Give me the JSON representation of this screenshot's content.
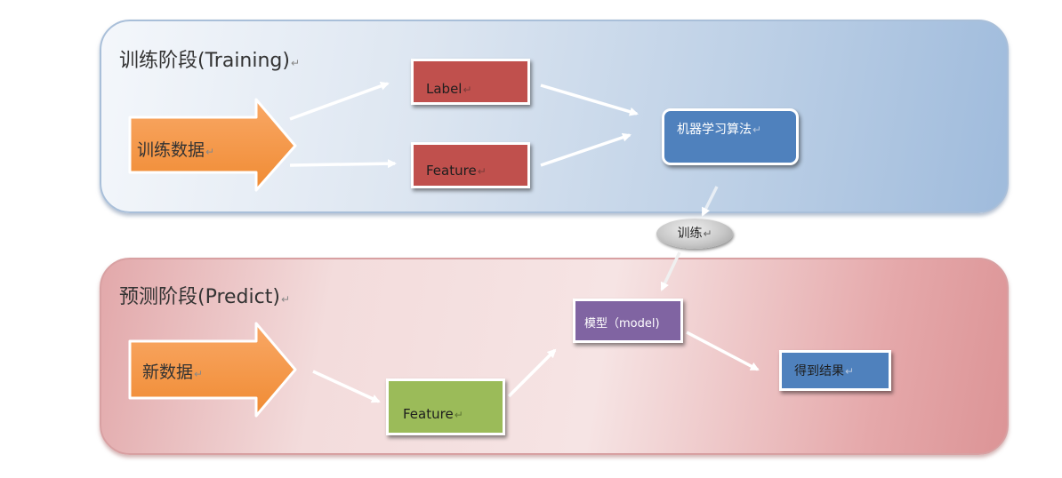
{
  "training_panel": {
    "title": "训练阶段(Training)",
    "input_label": "训练数据",
    "label_box": "Label",
    "feature_box": "Feature",
    "algorithm_box": "机器学习算法"
  },
  "train_badge": "训练",
  "predict_panel": {
    "title": "预测阶段(Predict)",
    "input_label": "新数据",
    "feature_box": "Feature",
    "model_box": "模型（model)",
    "result_box": "得到结果"
  },
  "paragraph_mark": "↵",
  "colors": {
    "training_panel_bg": "#bdd0e6",
    "predict_panel_bg": "#f3dcdc",
    "arrow_orange": "#f79646",
    "label_red": "#c0504d",
    "feature_green": "#9bbb59",
    "model_purple": "#8064a2",
    "algorithm_blue": "#4f81bd"
  },
  "icons": {
    "big_arrow": "block-arrow-right",
    "connectors": "arrow-right"
  }
}
